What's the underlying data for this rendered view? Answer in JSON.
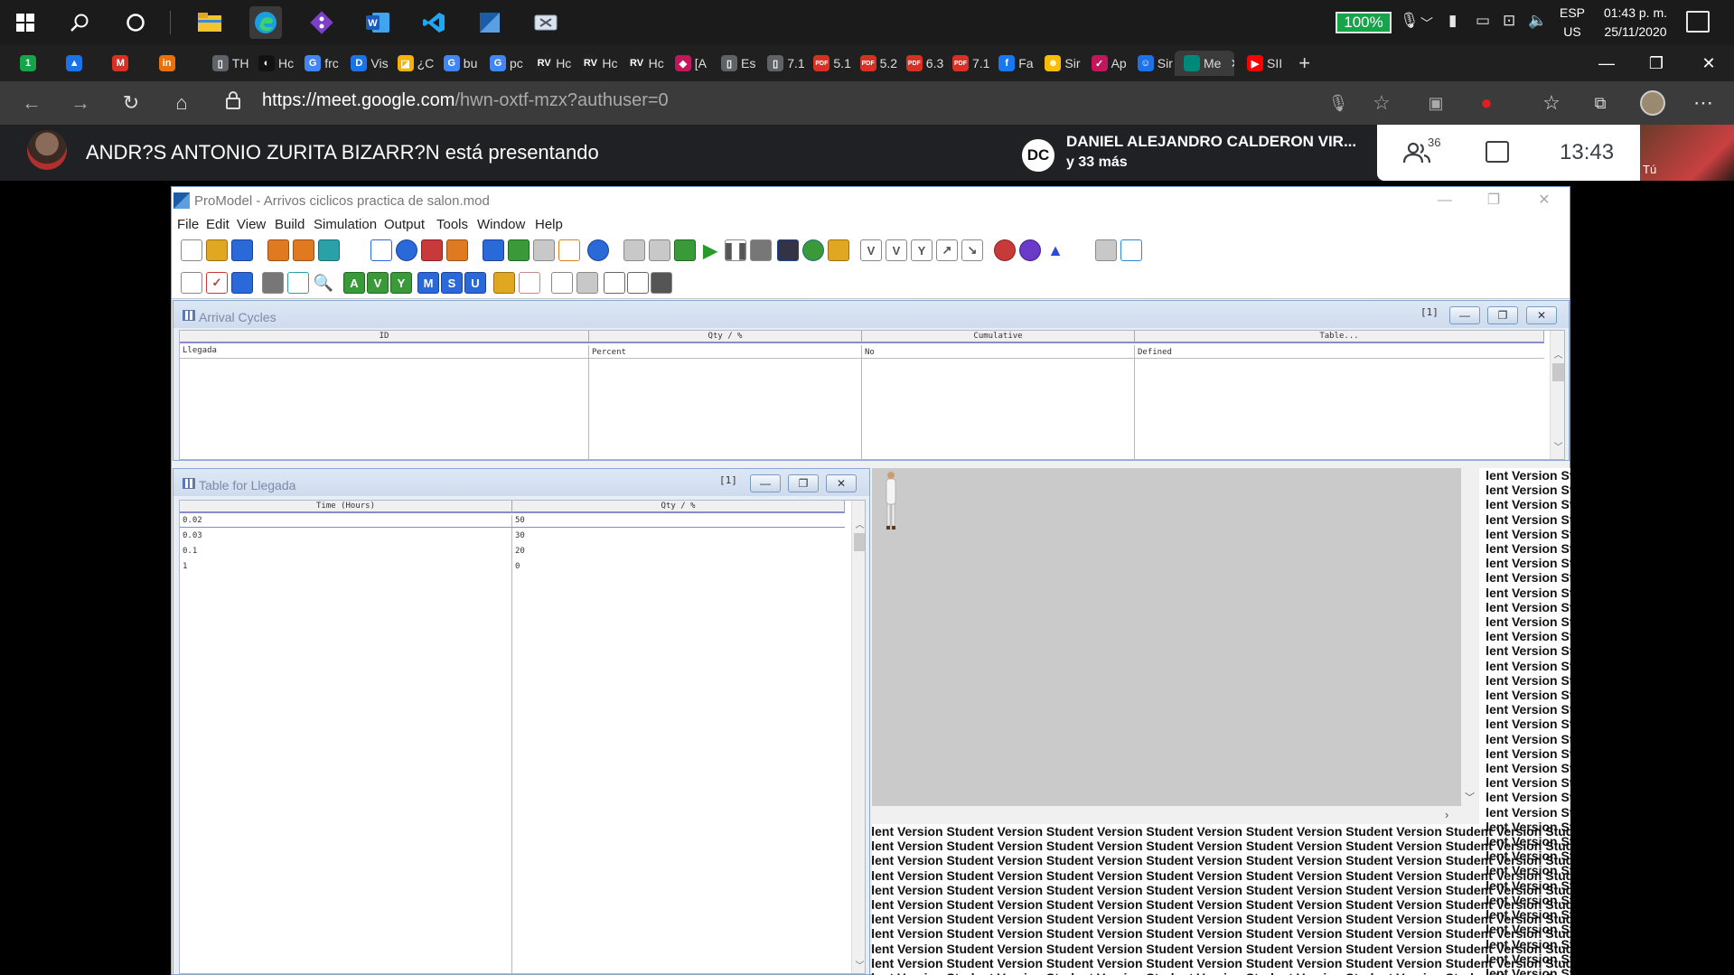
{
  "taskbar": {
    "battery_percent": "100%",
    "language_top": "ESP",
    "language_bottom": "US",
    "time": "01:43 p. m.",
    "date": "25/11/2020"
  },
  "browser": {
    "tabs": [
      {
        "label": "",
        "color": "#16a34a",
        "glyph": "1"
      },
      {
        "label": "",
        "color": "#1a73e8",
        "glyph": "▲"
      },
      {
        "label": "",
        "color": "#d93025",
        "glyph": "M"
      },
      {
        "label": "",
        "color": "#e8710a",
        "glyph": "in"
      },
      {
        "label": "TH",
        "color": "#5f6368",
        "glyph": "▯"
      },
      {
        "label": "Hc",
        "color": "#111111",
        "glyph": "◐"
      },
      {
        "label": "frc",
        "color": "#4285f4",
        "glyph": "G"
      },
      {
        "label": "Vis",
        "color": "#1a73e8",
        "glyph": "D"
      },
      {
        "label": "¿C",
        "color": "#f4b400",
        "glyph": "◪"
      },
      {
        "label": "bu",
        "color": "#4285f4",
        "glyph": "G"
      },
      {
        "label": "pc",
        "color": "#4285f4",
        "glyph": "G"
      },
      {
        "label": "Hc",
        "color": "#222222",
        "glyph": "RV"
      },
      {
        "label": "Hc",
        "color": "#222222",
        "glyph": "RV"
      },
      {
        "label": "Hc",
        "color": "#222222",
        "glyph": "RV"
      },
      {
        "label": "[A",
        "color": "#c2185b",
        "glyph": "◆"
      },
      {
        "label": "Es",
        "color": "#5f6368",
        "glyph": "▯"
      },
      {
        "label": "7.1",
        "color": "#5f6368",
        "glyph": "▯"
      },
      {
        "label": "5.1",
        "color": "#d93025",
        "glyph": "PDF"
      },
      {
        "label": "5.2",
        "color": "#d93025",
        "glyph": "PDF"
      },
      {
        "label": "6.3",
        "color": "#d93025",
        "glyph": "PDF"
      },
      {
        "label": "7.1",
        "color": "#d93025",
        "glyph": "PDF"
      },
      {
        "label": "Fa",
        "color": "#1877f2",
        "glyph": "f"
      },
      {
        "label": "Sir",
        "color": "#fbbc04",
        "glyph": "☻"
      },
      {
        "label": "Ap",
        "color": "#c2185b",
        "glyph": "✓"
      },
      {
        "label": "Sir",
        "color": "#1a73e8",
        "glyph": "☺"
      },
      {
        "label": "Me",
        "color": "#00897b",
        "glyph": ""
      },
      {
        "label": "SII",
        "color": "#ff0000",
        "glyph": "▶"
      }
    ],
    "new_tab": "+",
    "url_host": "https://meet.google.com",
    "url_path": "/hwn-oxtf-mzx?authuser=0"
  },
  "meet": {
    "presenting_text": "ANDR?S ANTONIO ZURITA BIZARR?N está presentando",
    "speaker_initials": "DC",
    "speaker_name": "DANIEL ALEJANDRO CALDERON VIR...",
    "speaker_more": "y 33 más",
    "people_count": "36",
    "time": "13:43",
    "self_label": "Tú"
  },
  "promodel": {
    "title": "ProModel - Arrivos ciclicos practica de salon.mod",
    "menu": [
      "File",
      "Edit",
      "View",
      "Build",
      "Simulation",
      "Output",
      "Tools",
      "Window",
      "Help"
    ],
    "toolbar1_letters": [],
    "toolbar2_letters": [
      "A",
      "V",
      "Y",
      "M",
      "S",
      "U"
    ],
    "arrival_cycles": {
      "title": "Arrival Cycles",
      "index": "[1]",
      "columns": [
        "ID",
        "Qty / %",
        "Cumulative",
        "Table..."
      ],
      "row": [
        "Llegada",
        "Percent",
        "No",
        "Defined"
      ]
    },
    "table_llegada": {
      "title": "Table for Llegada",
      "index": "[1]",
      "columns": [
        "Time (Hours)",
        "Qty / %"
      ],
      "rows": [
        [
          "0.02",
          "50"
        ],
        [
          "0.03",
          "30"
        ],
        [
          "0.1",
          "20"
        ],
        [
          "1",
          "0"
        ]
      ]
    },
    "watermark_word": "Student Version"
  }
}
